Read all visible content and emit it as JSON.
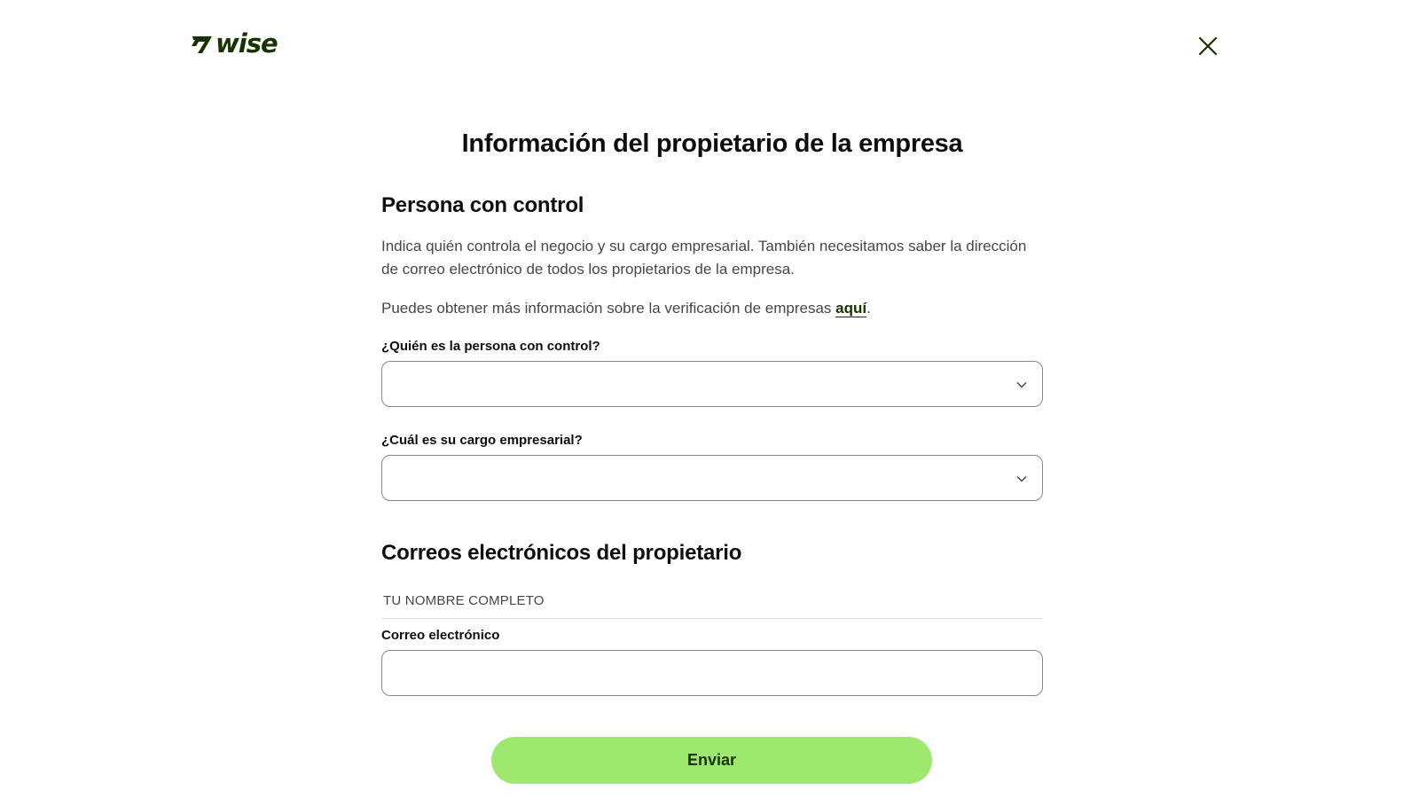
{
  "brand": {
    "name": "wise",
    "color": "#163300"
  },
  "header": {
    "close_icon": "close-icon"
  },
  "page": {
    "title": "Información del propietario de la empresa"
  },
  "control_section": {
    "title": "Persona con control",
    "description": "Indica quién controla el negocio y su cargo empresarial. También necesitamos saber la dirección de correo electrónico de todos los propietarios de la empresa.",
    "info_prefix": "Puedes obtener más información sobre la verificación de empresas ",
    "info_link": "aquí",
    "info_suffix": ".",
    "person_label": "¿Quién es la persona con control?",
    "person_value": "",
    "role_label": "¿Cuál es su cargo empresarial?",
    "role_value": ""
  },
  "emails_section": {
    "title": "Correos electrónicos del propietario",
    "owner_name": "TU NOMBRE COMPLETO",
    "email_label": "Correo electrónico",
    "email_value": ""
  },
  "actions": {
    "submit_label": "Enviar",
    "submit_color": "#9fe870"
  }
}
